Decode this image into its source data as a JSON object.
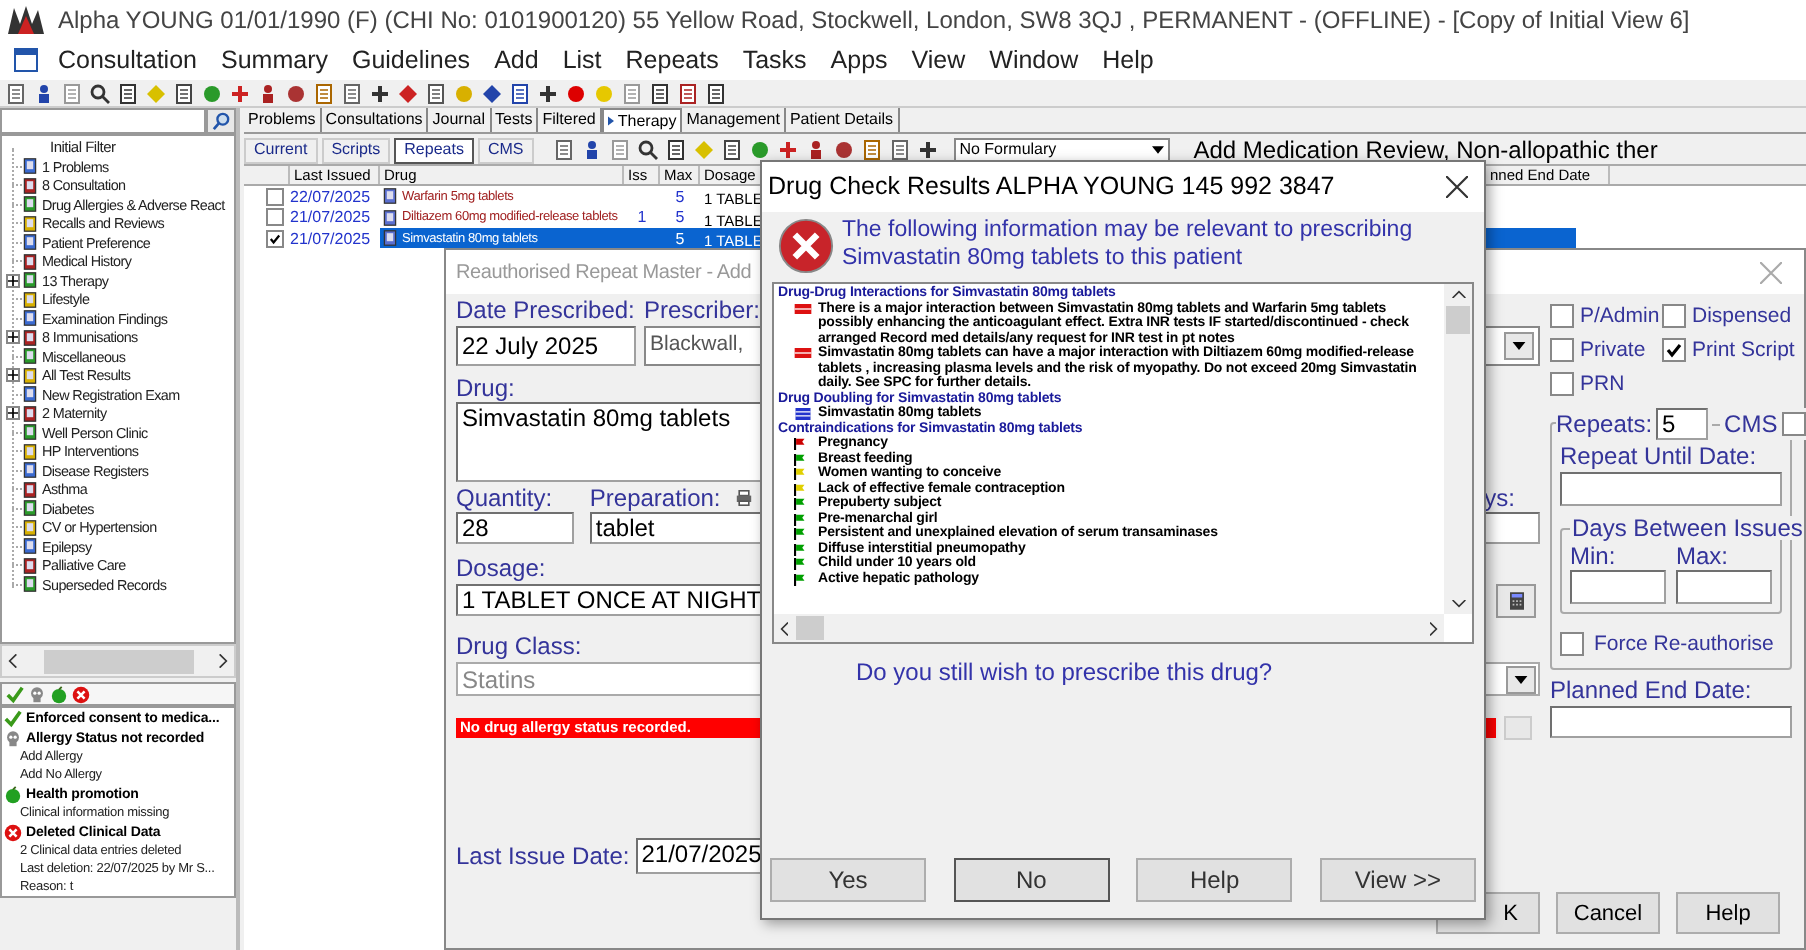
{
  "window": {
    "title": "Alpha YOUNG 01/01/1990 (F) (CHI No: 0101900120)  55 Yellow Road, Stockwell, London, SW8 3QJ , PERMANENT - (OFFLINE) - [Copy of Initial View 6]"
  },
  "menu": [
    "Consultation",
    "Summary",
    "Guidelines",
    "Add",
    "List",
    "Repeats",
    "Tasks",
    "Apps",
    "View",
    "Window",
    "Help"
  ],
  "tree": {
    "root": "Initial Filter",
    "items": [
      {
        "label": "1 Problems",
        "has_children": false
      },
      {
        "label": "8 Consultation",
        "has_children": false
      },
      {
        "label": "Drug Allergies & Adverse React",
        "has_children": false
      },
      {
        "label": "Recalls and Reviews",
        "has_children": false
      },
      {
        "label": "Patient Preference",
        "has_children": false
      },
      {
        "label": "Medical History",
        "has_children": false
      },
      {
        "label": "13 Therapy",
        "has_children": true
      },
      {
        "label": "Lifestyle",
        "has_children": false
      },
      {
        "label": "Examination Findings",
        "has_children": false
      },
      {
        "label": "8 Immunisations",
        "has_children": true
      },
      {
        "label": "Miscellaneous",
        "has_children": false
      },
      {
        "label": "All Test Results",
        "has_children": true
      },
      {
        "label": "New Registration Exam",
        "has_children": false
      },
      {
        "label": "2 Maternity",
        "has_children": true
      },
      {
        "label": "Well Person Clinic",
        "has_children": false
      },
      {
        "label": "HP Interventions",
        "has_children": false
      },
      {
        "label": "Disease Registers",
        "has_children": false
      },
      {
        "label": "Asthma",
        "has_children": false
      },
      {
        "label": "Diabetes",
        "has_children": false
      },
      {
        "label": "CV or Hypertension",
        "has_children": false
      },
      {
        "label": "Epilepsy",
        "has_children": false
      },
      {
        "label": "Palliative Care",
        "has_children": false
      },
      {
        "label": "Superseded Records",
        "has_children": false
      }
    ]
  },
  "alerts": [
    {
      "kind": "consent",
      "title": "Enforced consent to medica..."
    },
    {
      "kind": "allergy",
      "title": "Allergy Status not recorded",
      "details": [
        "Add Allergy",
        "Add No Allergy"
      ]
    },
    {
      "kind": "health",
      "title": "Health promotion",
      "details": [
        "Clinical information missing"
      ]
    },
    {
      "kind": "deleted",
      "title": "Deleted Clinical Data",
      "details": [
        "2 Clinical data entries deleted",
        "Last deletion: 22/07/2025 by Mr  S...",
        "Reason: t"
      ]
    }
  ],
  "tabs": [
    {
      "label": "Problems",
      "selected": false
    },
    {
      "label": "Consultations",
      "selected": false
    },
    {
      "label": "Journal",
      "selected": false
    },
    {
      "label": "Tests",
      "selected": false
    },
    {
      "label": "Filtered",
      "selected": false
    },
    {
      "label": "Therapy",
      "selected": true
    },
    {
      "label": "Management",
      "selected": false
    },
    {
      "label": "Patient Details",
      "selected": false
    }
  ],
  "subtabs": [
    {
      "label": "Current",
      "selected": false
    },
    {
      "label": "Scripts",
      "selected": false
    },
    {
      "label": "Repeats",
      "selected": true
    },
    {
      "label": "CMS",
      "selected": false
    }
  ],
  "formulary": {
    "value": "No Formulary"
  },
  "review_text": "Add Medication Review, Non-allopathic ther",
  "grid": {
    "columns": [
      "Last Issued",
      "Drug",
      "Iss",
      "Max",
      "Dosage",
      "nned End Date"
    ],
    "rows": [
      {
        "checked": false,
        "last_issued": "22/07/2025",
        "drug": "Warfarin 5mg tablets",
        "max": "5",
        "dosage": "1 TABLE",
        "selected": false
      },
      {
        "checked": false,
        "last_issued": "21/07/2025",
        "drug": "Diltiazem 60mg modified-release tablets",
        "iss": "1",
        "max": "5",
        "dosage": "1 TABLE",
        "selected": false
      },
      {
        "checked": true,
        "last_issued": "21/07/2025",
        "drug": "Simvastatin 80mg tablets",
        "max": "5",
        "dosage": "1 TABLE",
        "selected": true
      }
    ]
  },
  "repeat_master": {
    "title": "Reauthorised Repeat Master - Add",
    "date_prescribed": {
      "label": "Date Prescribed:",
      "value": "22 July 2025"
    },
    "prescriber": {
      "label": "Prescriber:",
      "value": "Blackwall,"
    },
    "drug": {
      "label": "Drug:",
      "value": "Simvastatin 80mg tablets"
    },
    "quantity": {
      "label": "Quantity:",
      "value": "28"
    },
    "preparation": {
      "label": "Preparation:",
      "value": "tablet"
    },
    "days": {
      "label": "ys:"
    },
    "dosage": {
      "label": "Dosage:",
      "value": "1 TABLET ONCE AT NIGHT"
    },
    "drug_class": {
      "label": "Drug Class:",
      "value": "Statins"
    },
    "allergy_warning": "No drug allergy status recorded.",
    "last_issue_date": {
      "label": "Last Issue Date:",
      "value": "21/07/2025"
    },
    "options": [
      {
        "label": "P/Admin",
        "checked": false
      },
      {
        "label": "Dispensed",
        "checked": false
      },
      {
        "label": "Private",
        "checked": false
      },
      {
        "label": "Print Script",
        "checked": true
      },
      {
        "label": "PRN",
        "checked": false
      }
    ],
    "repeats": {
      "label": "Repeats:",
      "value": "5"
    },
    "cms": {
      "label": "CMS",
      "checked": false
    },
    "repeat_until": {
      "label": "Repeat Until Date:"
    },
    "days_between": {
      "title": "Days Between Issues",
      "min_label": "Min:",
      "max_label": "Max:"
    },
    "force": {
      "label": "Force Re-authorise",
      "checked": false
    },
    "planned_end": {
      "label": "Planned End Date:"
    },
    "buttons": [
      "K",
      "Cancel",
      "Help"
    ]
  },
  "drug_check": {
    "title": "Drug Check Results  ALPHA YOUNG 145 992 3847",
    "message": "The following information may be relevant to prescribing Simvastatin 80mg tablets to this patient",
    "sections": [
      {
        "heading": "Drug-Drug Interactions for Simvastatin 80mg tablets",
        "items": [
          {
            "kind": "interaction",
            "text": "There is a major interaction between Simvastatin 80mg tablets and Warfarin 5mg tablets possibly enhancing the anticoagulant effect. Extra INR tests IF started/discontinued - check arranged Record med details/any request for INR test in pt notes"
          },
          {
            "kind": "interaction",
            "text": "Simvastatin 80mg tablets can have a major interaction with Diltiazem 60mg modified-release tablets , increasing plasma levels and the risk of myopathy. Do not exceed 20mg Simvastatin daily. See SPC for further details."
          }
        ]
      },
      {
        "heading": "Drug Doubling for Simvastatin 80mg tablets",
        "items": [
          {
            "kind": "doubling",
            "text": "Simvastatin 80mg tablets"
          }
        ]
      },
      {
        "heading": "Contraindications for Simvastatin 80mg tablets",
        "items": [
          {
            "kind": "flag",
            "color": "#cc0000",
            "text": "Pregnancy"
          },
          {
            "kind": "flag",
            "color": "#00a000",
            "text": "Breast feeding"
          },
          {
            "kind": "flag",
            "color": "#e0d000",
            "text": "Women wanting to conceive"
          },
          {
            "kind": "flag",
            "color": "#e0d000",
            "text": "Lack of effective female contraception"
          },
          {
            "kind": "flag",
            "color": "#00a000",
            "text": "Prepuberty subject"
          },
          {
            "kind": "flag",
            "color": "#00a000",
            "text": "Pre-menarchal girl"
          },
          {
            "kind": "flag",
            "color": "#00a000",
            "text": "Persistent and unexplained elevation of serum transaminases"
          },
          {
            "kind": "flag",
            "color": "#00a000",
            "text": "Diffuse interstitial pneumopathy"
          },
          {
            "kind": "flag",
            "color": "#00a000",
            "text": "Child under 10 years old"
          },
          {
            "kind": "flag",
            "color": "#00a000",
            "text": "Active hepatic pathology"
          }
        ]
      }
    ],
    "question": "Do you still wish to prescribe this drug?",
    "buttons": [
      "Yes",
      "No",
      "Help",
      "View >>"
    ]
  }
}
